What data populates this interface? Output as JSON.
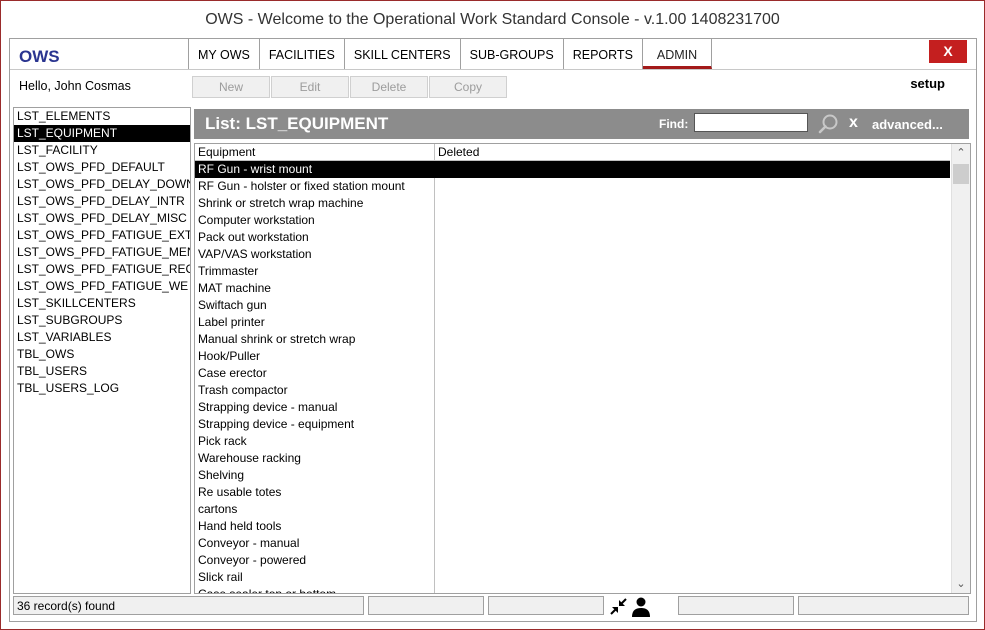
{
  "window": {
    "title": "OWS - Welcome to the Operational Work Standard Console - v.1.00 1408231700"
  },
  "header": {
    "logo": "OWS",
    "tabs": [
      "MY OWS",
      "FACILITIES",
      "SKILL CENTERS",
      "SUB-GROUPS",
      "REPORTS",
      "ADMIN"
    ],
    "active_tab": "ADMIN",
    "close_label": "X"
  },
  "toolbar": {
    "greeting": "Hello, John Cosmas",
    "new_label": "New",
    "edit_label": "Edit",
    "delete_label": "Delete",
    "copy_label": "Copy",
    "setup_label": "setup"
  },
  "sidebar": {
    "items": [
      "LST_ELEMENTS",
      "LST_EQUIPMENT",
      "LST_FACILITY",
      "LST_OWS_PFD_DEFAULT",
      "LST_OWS_PFD_DELAY_DOWN",
      "LST_OWS_PFD_DELAY_INTR",
      "LST_OWS_PFD_DELAY_MISC",
      "LST_OWS_PFD_FATIGUE_EXT",
      "LST_OWS_PFD_FATIGUE_MEN",
      "LST_OWS_PFD_FATIGUE_REC",
      "LST_OWS_PFD_FATIGUE_WE",
      "LST_SKILLCENTERS",
      "LST_SUBGROUPS",
      "LST_VARIABLES",
      "TBL_OWS",
      "TBL_USERS",
      "TBL_USERS_LOG"
    ],
    "selected": "LST_EQUIPMENT"
  },
  "panel": {
    "title": "List: LST_EQUIPMENT",
    "find_label": "Find:",
    "find_value": "",
    "clear_label": "x",
    "advanced_label": "advanced..."
  },
  "table": {
    "columns": [
      "Equipment",
      "Deleted"
    ],
    "selected_row": 0,
    "rows": [
      [
        "RF Gun - wrist mount",
        ""
      ],
      [
        "RF Gun - holster or fixed station mount",
        ""
      ],
      [
        "Shrink or stretch wrap machine",
        ""
      ],
      [
        "Computer workstation",
        ""
      ],
      [
        "Pack out workstation",
        ""
      ],
      [
        "VAP/VAS workstation",
        ""
      ],
      [
        "Trimmaster",
        ""
      ],
      [
        "MAT machine",
        ""
      ],
      [
        "Swiftach gun",
        ""
      ],
      [
        "Label printer",
        ""
      ],
      [
        "Manual shrink or stretch wrap",
        ""
      ],
      [
        "Hook/Puller",
        ""
      ],
      [
        "Case erector",
        ""
      ],
      [
        "Trash compactor",
        ""
      ],
      [
        "Strapping device - manual",
        ""
      ],
      [
        "Strapping device - equipment",
        ""
      ],
      [
        "Pick rack",
        ""
      ],
      [
        "Warehouse racking",
        ""
      ],
      [
        "Shelving",
        ""
      ],
      [
        "Re usable totes",
        ""
      ],
      [
        "cartons",
        ""
      ],
      [
        "Hand held tools",
        ""
      ],
      [
        "Conveyor - manual",
        ""
      ],
      [
        "Conveyor - powered",
        ""
      ],
      [
        "Slick rail",
        ""
      ],
      [
        "Case sealer top or bottom",
        ""
      ]
    ]
  },
  "status": {
    "record_count": "36 record(s) found"
  },
  "colors": {
    "accent_red": "#c41f1f",
    "logo_blue": "#2a3590",
    "panel_header": "#8c8c8c"
  },
  "icons": {
    "search": "search-icon",
    "collapse": "collapse-arrows-icon",
    "user": "user-icon"
  }
}
